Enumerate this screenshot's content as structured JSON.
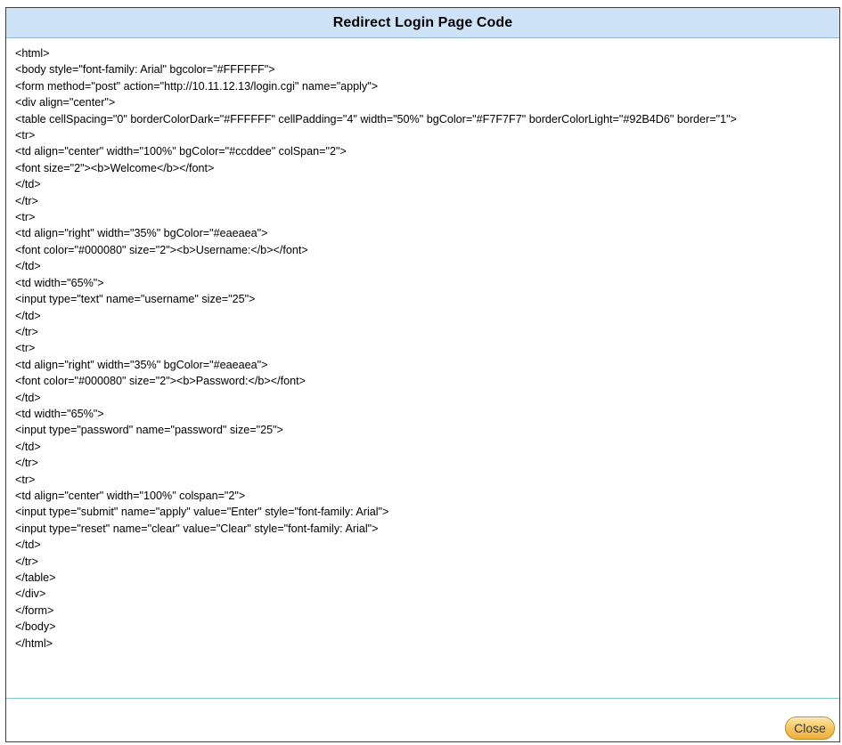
{
  "dialog": {
    "title": "Redirect Login Page Code",
    "close_label": "Close"
  },
  "code_lines": [
    "<html>",
    "<body style=\"font-family: Arial\" bgcolor=\"#FFFFFF\">",
    "<form method=\"post\" action=\"http://10.11.12.13/login.cgi\" name=\"apply\">",
    "<div align=\"center\">",
    "<table cellSpacing=\"0\" borderColorDark=\"#FFFFFF\" cellPadding=\"4\" width=\"50%\" bgColor=\"#F7F7F7\" borderColorLight=\"#92B4D6\" border=\"1\">",
    "<tr>",
    "<td align=\"center\" width=\"100%\" bgColor=\"#ccddee\" colSpan=\"2\">",
    "<font size=\"2\"><b>Welcome</b></font>",
    "</td>",
    "</tr>",
    "<tr>",
    "<td align=\"right\" width=\"35%\" bgColor=\"#eaeaea\">",
    "<font color=\"#000080\" size=\"2\"><b>Username:</b></font>",
    "</td>",
    "<td width=\"65%\">",
    "<input type=\"text\" name=\"username\" size=\"25\">",
    "</td>",
    "</tr>",
    "<tr>",
    "<td align=\"right\" width=\"35%\" bgColor=\"#eaeaea\">",
    "<font color=\"#000080\" size=\"2\"><b>Password:</b></font>",
    "</td>",
    "<td width=\"65%\">",
    "<input type=\"password\" name=\"password\" size=\"25\">",
    "</td>",
    "</tr>",
    "<tr>",
    "<td align=\"center\" width=\"100%\" colspan=\"2\">",
    "<input type=\"submit\" name=\"apply\" value=\"Enter\" style=\"font-family: Arial\">",
    "<input type=\"reset\" name=\"clear\" value=\"Clear\" style=\"font-family: Arial\">",
    "</td>",
    "</tr>",
    "</table>",
    "</div>",
    "</form>",
    "</body>",
    "</html>"
  ]
}
